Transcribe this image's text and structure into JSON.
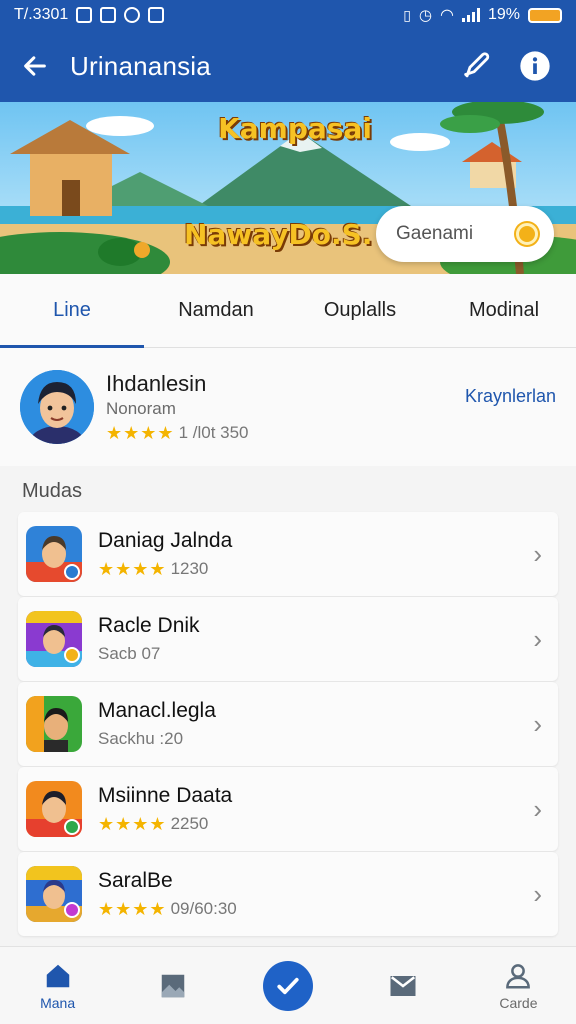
{
  "status_bar": {
    "time": "T/.3301",
    "battery": "19%"
  },
  "app_bar": {
    "title": "Urinanansia",
    "back_icon": "arrow-left-icon",
    "action_icons": [
      "pen-icon",
      "info-icon"
    ]
  },
  "banner": {
    "title": "Kampasai",
    "subtitle": "NawayDo.S.",
    "search_placeholder": "Gaenami"
  },
  "tabs": [
    {
      "label": "Line",
      "active": true
    },
    {
      "label": "Namdan",
      "active": false
    },
    {
      "label": "Ouplalls",
      "active": false
    },
    {
      "label": "Modinal",
      "active": false
    }
  ],
  "profile": {
    "name": "Ihdanlesin",
    "subtitle": "Nonoram",
    "rating_text": "1 /l0t 350",
    "stars": 4,
    "link": "Kraynlerlan"
  },
  "section_label": "Mudas",
  "list": [
    {
      "title": "Daniag Jalnda",
      "meta": "1230",
      "stars": 4
    },
    {
      "title": "Racle Dnik",
      "meta": "Sacb 07",
      "stars": 0
    },
    {
      "title": "Manacl.legla",
      "meta": "Sackhu :20",
      "stars": 0
    },
    {
      "title": "Msiinne Daata",
      "meta": "2250",
      "stars": 4
    },
    {
      "title": "SaralBe",
      "meta": "09/60:30",
      "stars": 4
    }
  ],
  "bottom_nav": [
    {
      "label": "Mana",
      "icon": "home-icon"
    },
    {
      "label": "",
      "icon": "image-icon"
    },
    {
      "label": "",
      "icon": "check-icon"
    },
    {
      "label": "",
      "icon": "mail-icon"
    },
    {
      "label": "Carde",
      "icon": "profile-icon"
    }
  ],
  "colors": {
    "primary": "#1f56ad",
    "star": "#f4b400"
  }
}
